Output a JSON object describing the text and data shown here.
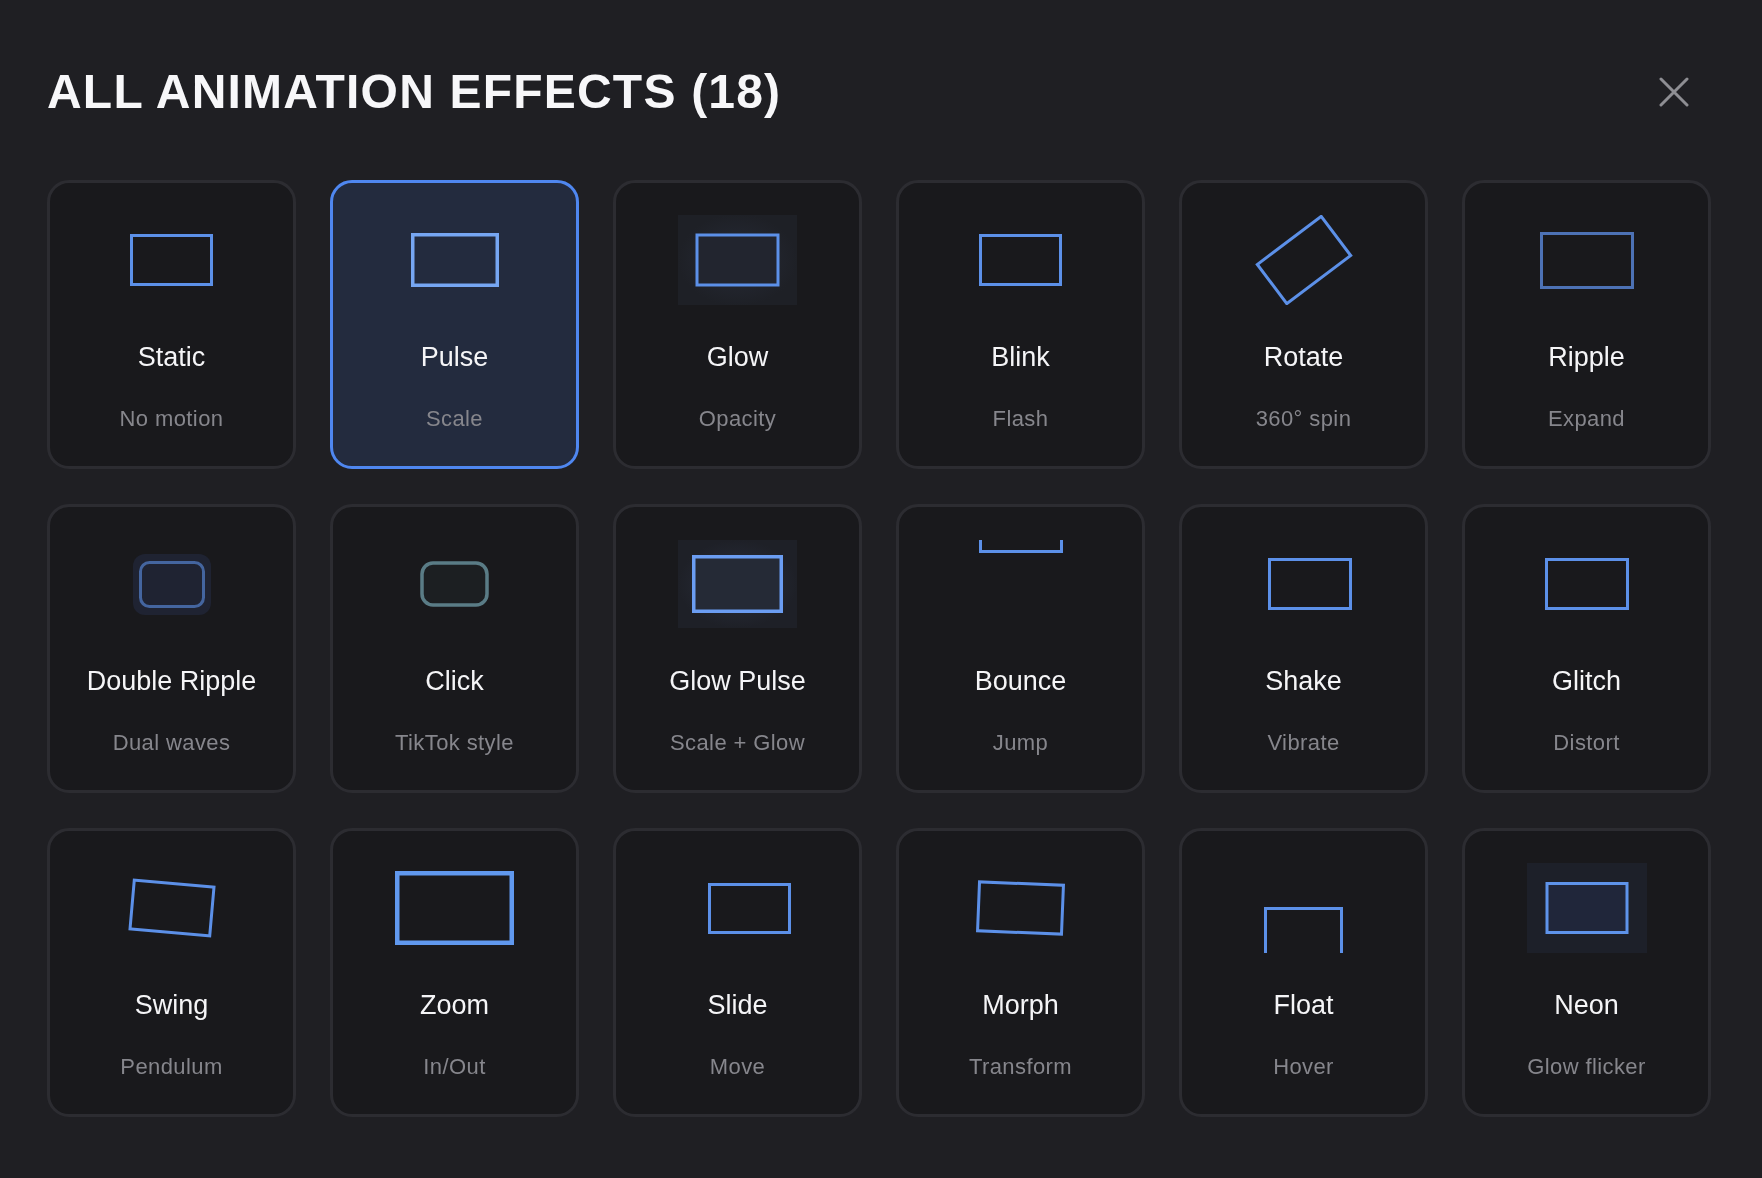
{
  "dialog": {
    "title": "ALL ANIMATION EFFECTS (18)"
  },
  "effects": [
    {
      "name": "Static",
      "description": "No motion",
      "kind": "static",
      "selected": false
    },
    {
      "name": "Pulse",
      "description": "Scale",
      "kind": "pulse",
      "selected": true
    },
    {
      "name": "Glow",
      "description": "Opacity",
      "kind": "glow",
      "selected": false
    },
    {
      "name": "Blink",
      "description": "Flash",
      "kind": "blink",
      "selected": false
    },
    {
      "name": "Rotate",
      "description": "360° spin",
      "kind": "rotate",
      "selected": false
    },
    {
      "name": "Ripple",
      "description": "Expand",
      "kind": "ripple",
      "selected": false
    },
    {
      "name": "Double Ripple",
      "description": "Dual waves",
      "kind": "doubleripple",
      "selected": false
    },
    {
      "name": "Click",
      "description": "TikTok style",
      "kind": "click",
      "selected": false
    },
    {
      "name": "Glow Pulse",
      "description": "Scale + Glow",
      "kind": "glowpulse",
      "selected": false
    },
    {
      "name": "Bounce",
      "description": "Jump",
      "kind": "bounce",
      "selected": false
    },
    {
      "name": "Shake",
      "description": "Vibrate",
      "kind": "shake",
      "selected": false
    },
    {
      "name": "Glitch",
      "description": "Distort",
      "kind": "glitch",
      "selected": false
    },
    {
      "name": "Swing",
      "description": "Pendulum",
      "kind": "swing",
      "selected": false
    },
    {
      "name": "Zoom",
      "description": "In/Out",
      "kind": "zoom",
      "selected": false
    },
    {
      "name": "Slide",
      "description": "Move",
      "kind": "slide",
      "selected": false
    },
    {
      "name": "Morph",
      "description": "Transform",
      "kind": "morph",
      "selected": false
    },
    {
      "name": "Float",
      "description": "Hover",
      "kind": "float",
      "selected": false
    },
    {
      "name": "Neon",
      "description": "Glow flicker",
      "kind": "neon",
      "selected": false
    }
  ]
}
